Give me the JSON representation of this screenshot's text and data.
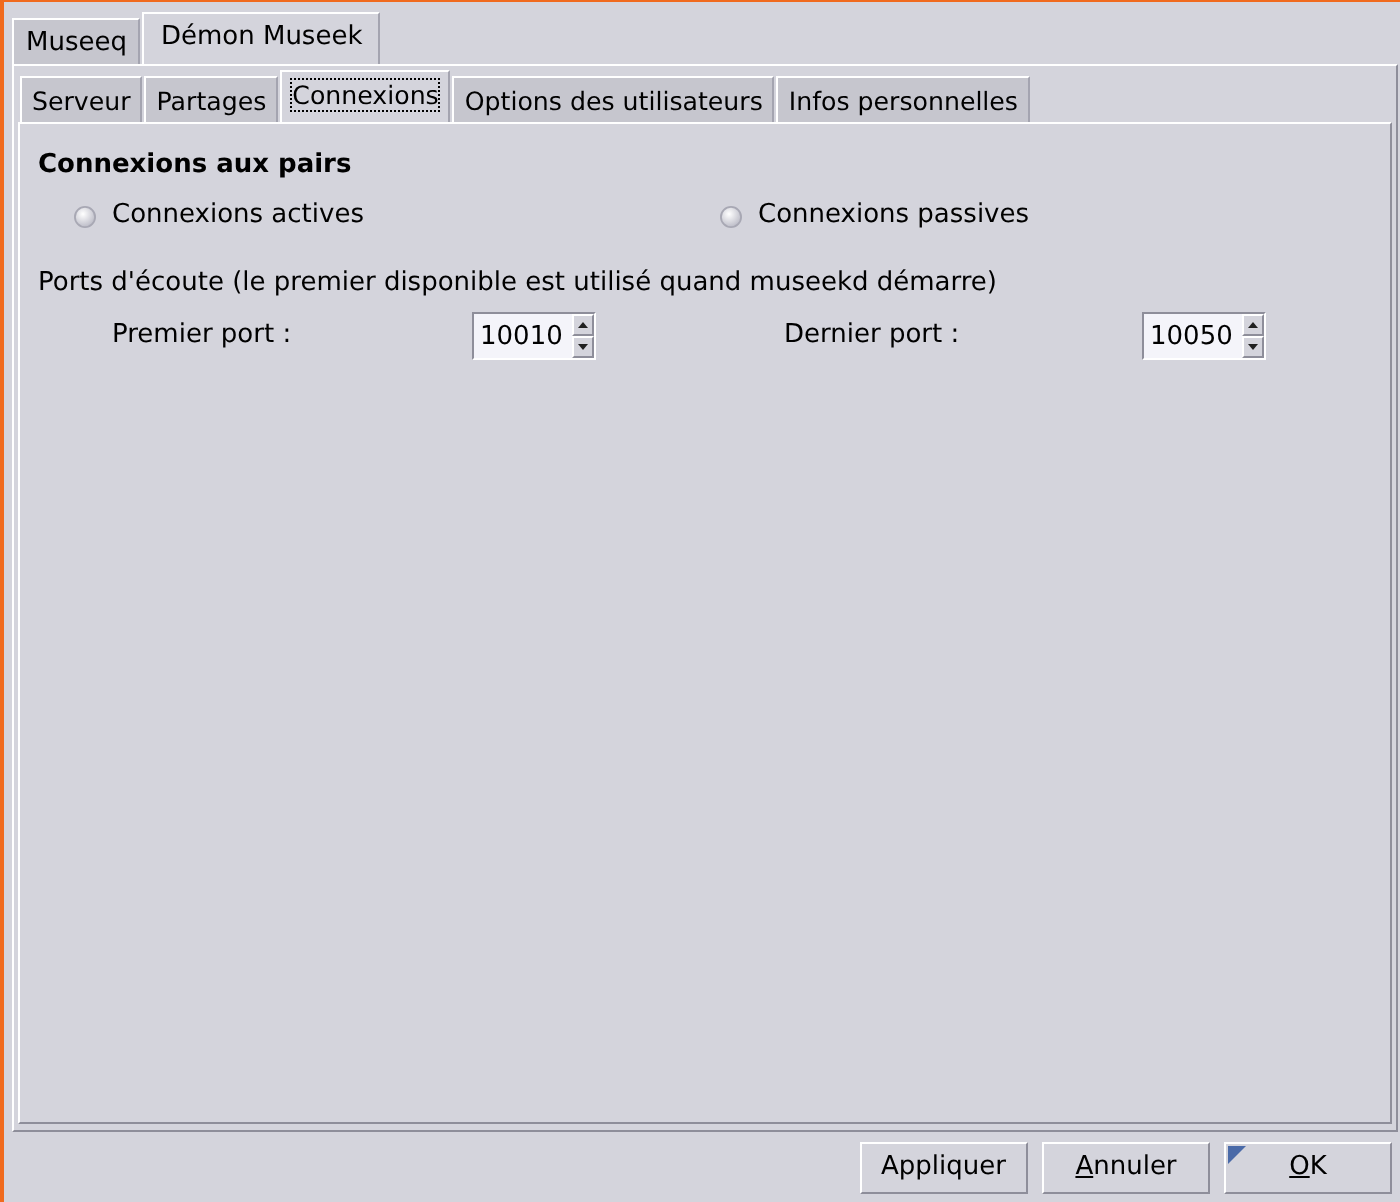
{
  "tabs": [
    {
      "label": "Museeq",
      "selected": false
    },
    {
      "label": "Démon Museek",
      "selected": true
    }
  ],
  "subtabs": [
    {
      "label": "Serveur",
      "selected": false,
      "focused": false
    },
    {
      "label": "Partages",
      "selected": false,
      "focused": false
    },
    {
      "label": "Connexions",
      "selected": true,
      "focused": true
    },
    {
      "label": "Options des utilisateurs",
      "selected": false,
      "focused": false
    },
    {
      "label": "Infos personnelles",
      "selected": false,
      "focused": false
    }
  ],
  "peers": {
    "title": "Connexions aux pairs",
    "options": [
      {
        "label": "Connexions actives",
        "selected": false
      },
      {
        "label": "Connexions passives",
        "selected": false
      }
    ]
  },
  "ports": {
    "label": "Ports d'écoute (le premier disponible est utilisé quand museekd démarre)",
    "fields": [
      {
        "label": "Premier port :",
        "value": "10010"
      },
      {
        "label": "Dernier port :",
        "value": "10050"
      }
    ]
  },
  "buttons": [
    {
      "label": "Appliquer",
      "mnemonic_first": false,
      "default": false
    },
    {
      "label": "Annuler",
      "mnemonic_first": true,
      "default": false
    },
    {
      "label": "OK",
      "mnemonic_first": true,
      "default": true
    }
  ]
}
